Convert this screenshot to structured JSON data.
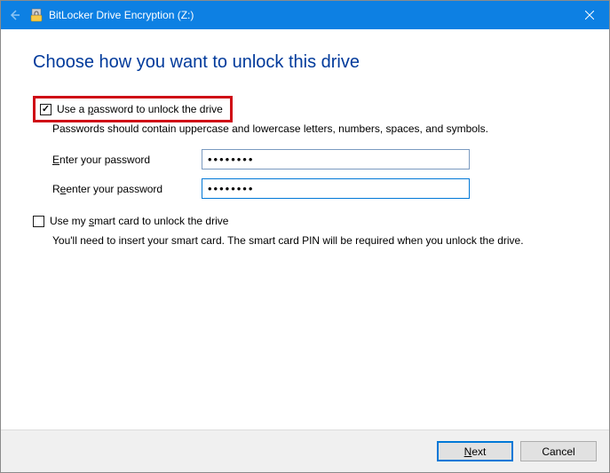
{
  "titlebar": {
    "title": "BitLocker Drive Encryption (Z:)"
  },
  "heading": "Choose how you want to unlock this drive",
  "password_option": {
    "checkbox_label_pre": "Use a ",
    "checkbox_label_ul": "p",
    "checkbox_label_post": "assword to unlock the drive",
    "checked": true,
    "description": "Passwords should contain uppercase and lowercase letters, numbers, spaces, and symbols.",
    "enter_label_ul": "E",
    "enter_label_post": "nter your password",
    "enter_value": "••••••••",
    "reenter_label_pre": "R",
    "reenter_label_ul": "e",
    "reenter_label_post": "enter your password",
    "reenter_value": "••••••••"
  },
  "smartcard_option": {
    "checkbox_label_pre": "Use my ",
    "checkbox_label_ul": "s",
    "checkbox_label_post": "mart card to unlock the drive",
    "checked": false,
    "description": "You'll need to insert your smart card. The smart card PIN will be required when you unlock the drive."
  },
  "footer": {
    "next_ul": "N",
    "next_post": "ext",
    "cancel": "Cancel"
  }
}
